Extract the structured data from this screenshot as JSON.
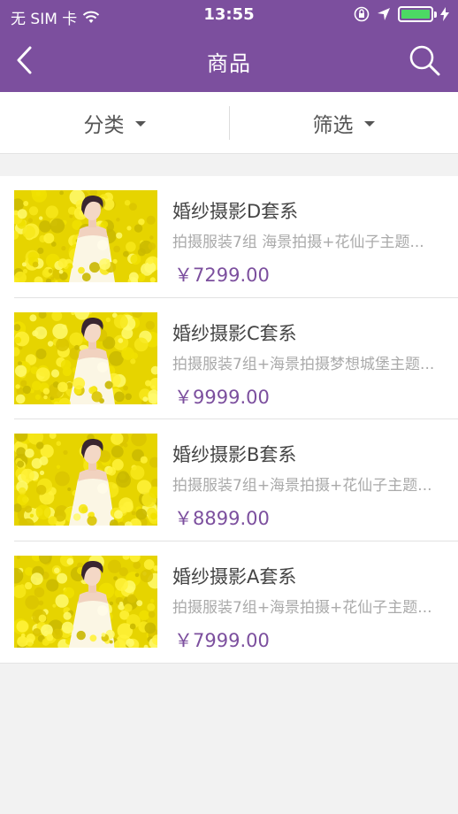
{
  "status": {
    "carrier": "无 SIM 卡",
    "time": "13:55",
    "battery_level": 1.0
  },
  "nav": {
    "title": "商品",
    "back_icon": "chevron-left-icon",
    "search_icon": "search-icon"
  },
  "filters": {
    "category": "分类",
    "filter": "筛选"
  },
  "colors": {
    "brand": "#7c4f9e",
    "price": "#7c4f9e",
    "battery": "#4cd964"
  },
  "products": [
    {
      "title": "婚纱摄影D套系",
      "desc": "拍摄服装7组 海景拍摄+花仙子主题...",
      "price": "￥7299.00"
    },
    {
      "title": "婚纱摄影C套系",
      "desc": "拍摄服装7组+海景拍摄梦想城堡主题...",
      "price": "￥9999.00"
    },
    {
      "title": "婚纱摄影B套系",
      "desc": "拍摄服装7组+海景拍摄+花仙子主题...",
      "price": "￥8899.00"
    },
    {
      "title": "婚纱摄影A套系",
      "desc": "拍摄服装7组+海景拍摄+花仙子主题...",
      "price": "￥7999.00"
    }
  ]
}
